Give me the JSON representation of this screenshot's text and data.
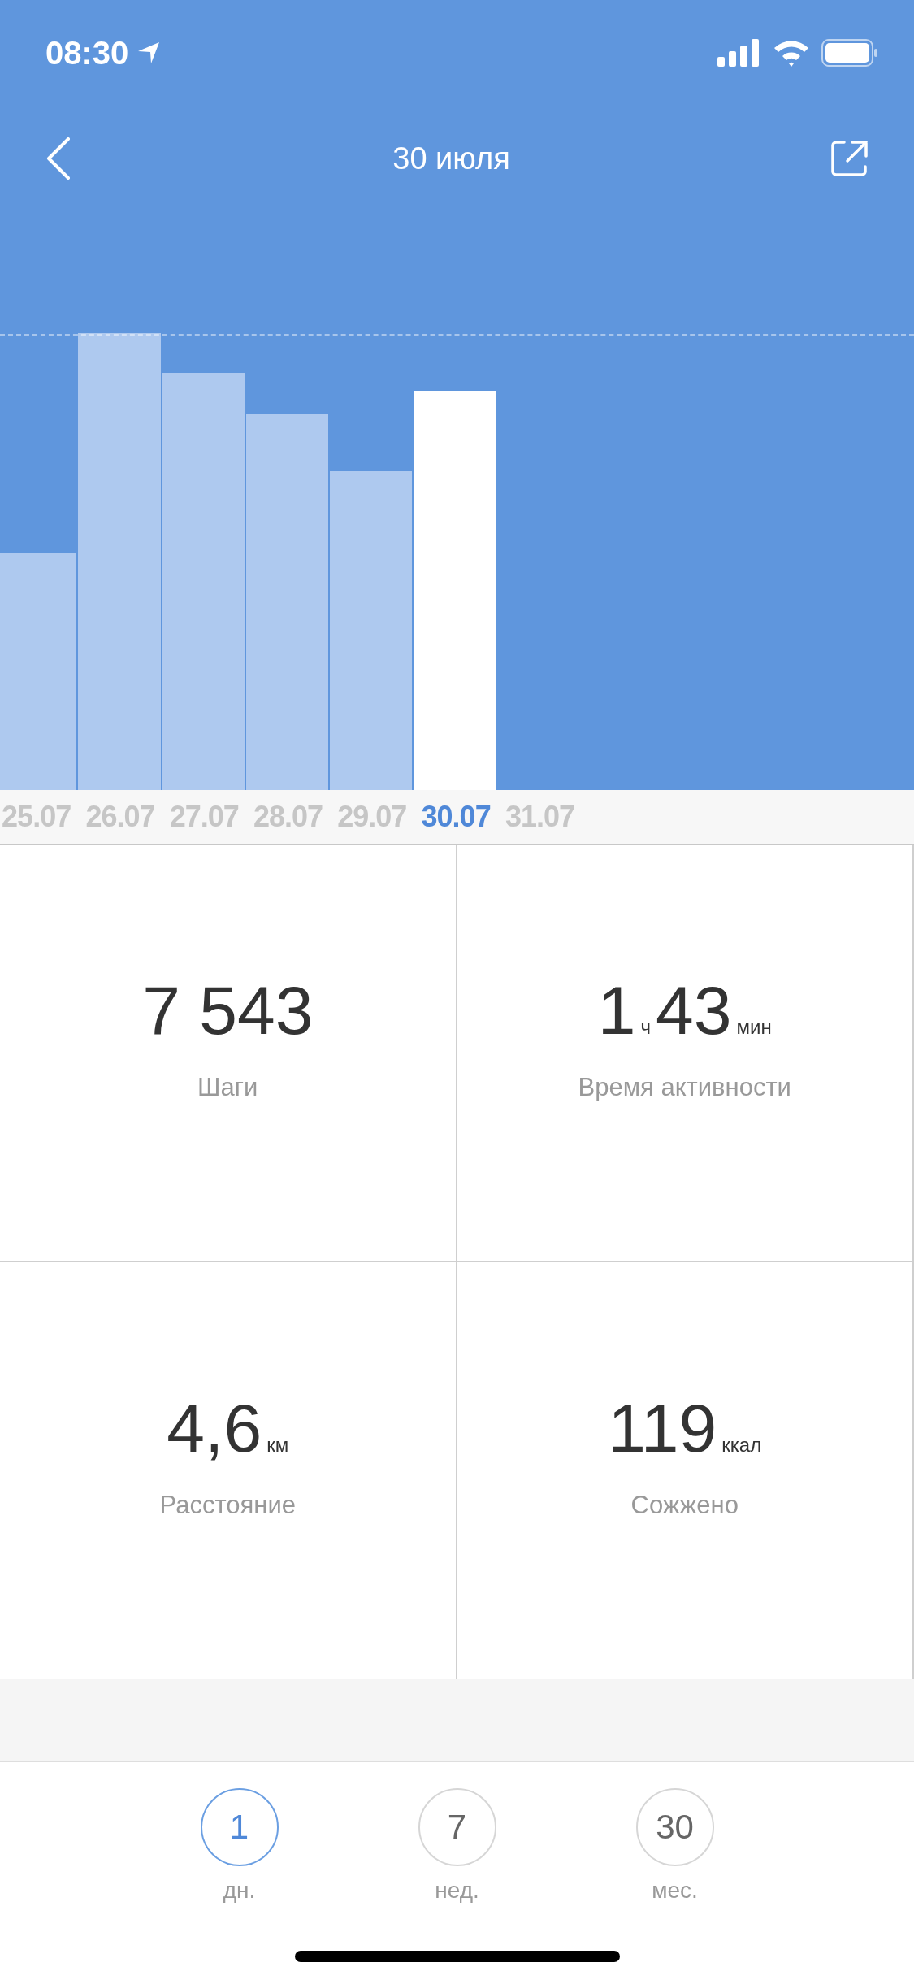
{
  "status_bar": {
    "time": "08:30"
  },
  "header": {
    "title": "30 июля"
  },
  "days": [
    {
      "date": "25.07",
      "selected": false
    },
    {
      "date": "26.07",
      "selected": false
    },
    {
      "date": "27.07",
      "selected": false
    },
    {
      "date": "28.07",
      "selected": false
    },
    {
      "date": "29.07",
      "selected": false
    },
    {
      "date": "30.07",
      "selected": true
    },
    {
      "date": "31.07",
      "selected": false
    }
  ],
  "stats": [
    {
      "parts": [
        {
          "value": "7 543"
        }
      ],
      "label": "Шаги"
    },
    {
      "parts": [
        {
          "value": "1",
          "unit": "ч"
        },
        {
          "value": "43",
          "unit": "мин"
        }
      ],
      "label": "Время активности"
    },
    {
      "parts": [
        {
          "value": "4,6",
          "unit": "км"
        }
      ],
      "label": "Расстояние"
    },
    {
      "parts": [
        {
          "value": "119",
          "unit": "ккал"
        }
      ],
      "label": "Сожжено"
    }
  ],
  "periods": [
    {
      "number": "1",
      "label": "дн.",
      "selected": true
    },
    {
      "number": "7",
      "label": "нед.",
      "selected": false
    },
    {
      "number": "30",
      "label": "мес.",
      "selected": false
    }
  ]
}
